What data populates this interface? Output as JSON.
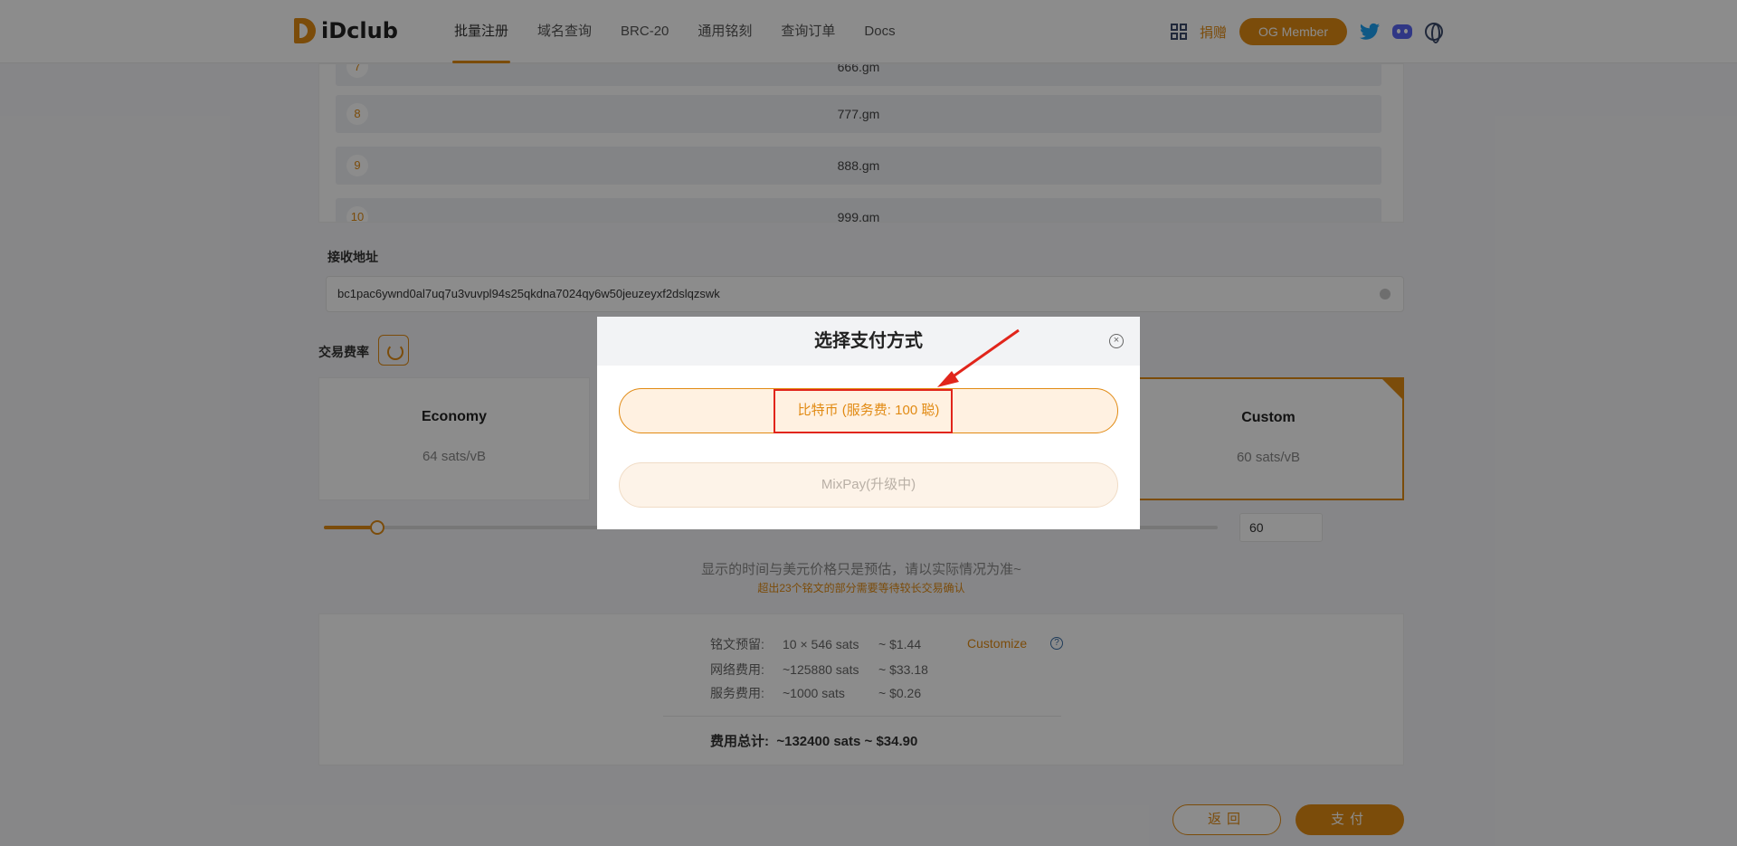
{
  "header": {
    "logo_text": "iDclub",
    "nav": [
      "批量注册",
      "域名查询",
      "BRC-20",
      "通用铭刻",
      "查询订单",
      "Docs"
    ],
    "active_nav": "批量注册",
    "donate_label": "捐赠",
    "og_member_label": "OG Member"
  },
  "domain_list": [
    {
      "index": "8",
      "name": "777.gm"
    },
    {
      "index": "9",
      "name": "888.gm"
    },
    {
      "index": "10",
      "name": "999.gm"
    },
    {
      "index": "7",
      "name": "666.gm"
    }
  ],
  "address": {
    "label": "接收地址",
    "value": "bc1pac6ywnd0al7uq7u3vuvpl94s25qkdna7024qy6w50jeuzeyxf2dslqzswk"
  },
  "fee": {
    "label": "交易费率",
    "cards": [
      {
        "title": "Economy",
        "value": "64 sats/vB"
      },
      {
        "title": "Custom",
        "value": "60 sats/vB"
      }
    ],
    "selected": "Custom",
    "slider_fraction": 0.06,
    "custom_value": "60",
    "note": "显示的时间与美元价格只是预估，请以实际情况为准~",
    "warning": "超出23个铭文的部分需要等待较长交易确认"
  },
  "summary": {
    "rows": [
      {
        "key": "铭文预留:",
        "amount": "10 × 546  sats",
        "usd": "~ $1.44"
      },
      {
        "key": "网络费用:",
        "amount": "~125880  sats",
        "usd": "~ $33.18"
      },
      {
        "key": "服务费用:",
        "amount": "~1000  sats",
        "usd": "~ $0.26"
      }
    ],
    "customize_label": "Customize",
    "total_key": "费用总计:",
    "total_value": "~132400  sats ~ $34.90"
  },
  "actions": {
    "back_label": "返回",
    "pay_label": "支付"
  },
  "modal": {
    "title": "选择支付方式",
    "options": [
      {
        "label": "比特币 (服务费: 100 聪)",
        "enabled": true
      },
      {
        "label": "MixPay(升级中)",
        "enabled": false
      }
    ]
  },
  "colors": {
    "accent": "#e18a13",
    "highlight_box": "#e1251b"
  }
}
